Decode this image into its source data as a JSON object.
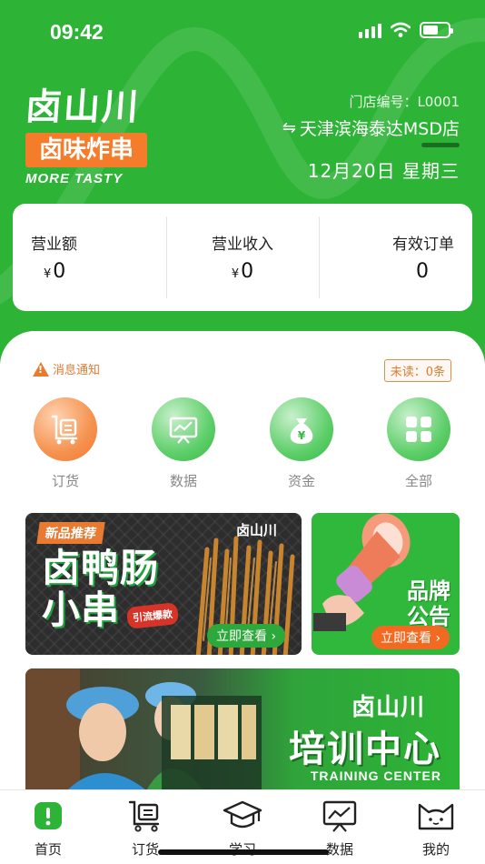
{
  "status": {
    "time": "09:42"
  },
  "logo": {
    "main": "卤山川",
    "sub": "卤味炸串",
    "tagline": "MORE TASTY"
  },
  "store": {
    "number_label": "门店编号：L0001",
    "name": "天津滨海泰达MSD店",
    "switch_symbol": "⇋",
    "date": "12月20日 星期三"
  },
  "stats": [
    {
      "label": "营业额",
      "currency": "¥",
      "value": "0"
    },
    {
      "label": "营业收入",
      "currency": "¥",
      "value": "0"
    },
    {
      "label": "有效订单",
      "currency": "",
      "value": "0"
    }
  ],
  "notice": {
    "label": "消息通知",
    "unread": "未读：0条"
  },
  "quick_actions": [
    {
      "label": "订货",
      "icon": "cart-icon",
      "color": "#f07a32"
    },
    {
      "label": "数据",
      "icon": "chart-board-icon",
      "color": "#34b944"
    },
    {
      "label": "资金",
      "icon": "money-bag-icon",
      "color": "#34b944"
    },
    {
      "label": "全部",
      "icon": "grid-icon",
      "color": "#34b944"
    }
  ],
  "banners": {
    "promo": {
      "tag": "新品推荐",
      "title_line1": "卤鸭肠",
      "title_line2": "小串",
      "badge": "引流爆款",
      "brand": "卤山川",
      "button": "立即查看 ›"
    },
    "announcement": {
      "title_line1": "品牌",
      "title_line2": "公告",
      "button": "立即查看 ›"
    },
    "training": {
      "brand": "卤山川",
      "title": "培训中心",
      "subtitle": "TRAINING CENTER"
    }
  },
  "tabbar": [
    {
      "label": "首页",
      "icon": "home-icon",
      "active": true
    },
    {
      "label": "订货",
      "icon": "cart-icon",
      "active": false
    },
    {
      "label": "学习",
      "icon": "graduation-cap-icon",
      "active": false
    },
    {
      "label": "数据",
      "icon": "chart-board-icon",
      "active": false
    },
    {
      "label": "我的",
      "icon": "cat-face-icon",
      "active": false
    }
  ],
  "colors": {
    "brand_green": "#2db436",
    "accent_orange": "#f07a32"
  }
}
